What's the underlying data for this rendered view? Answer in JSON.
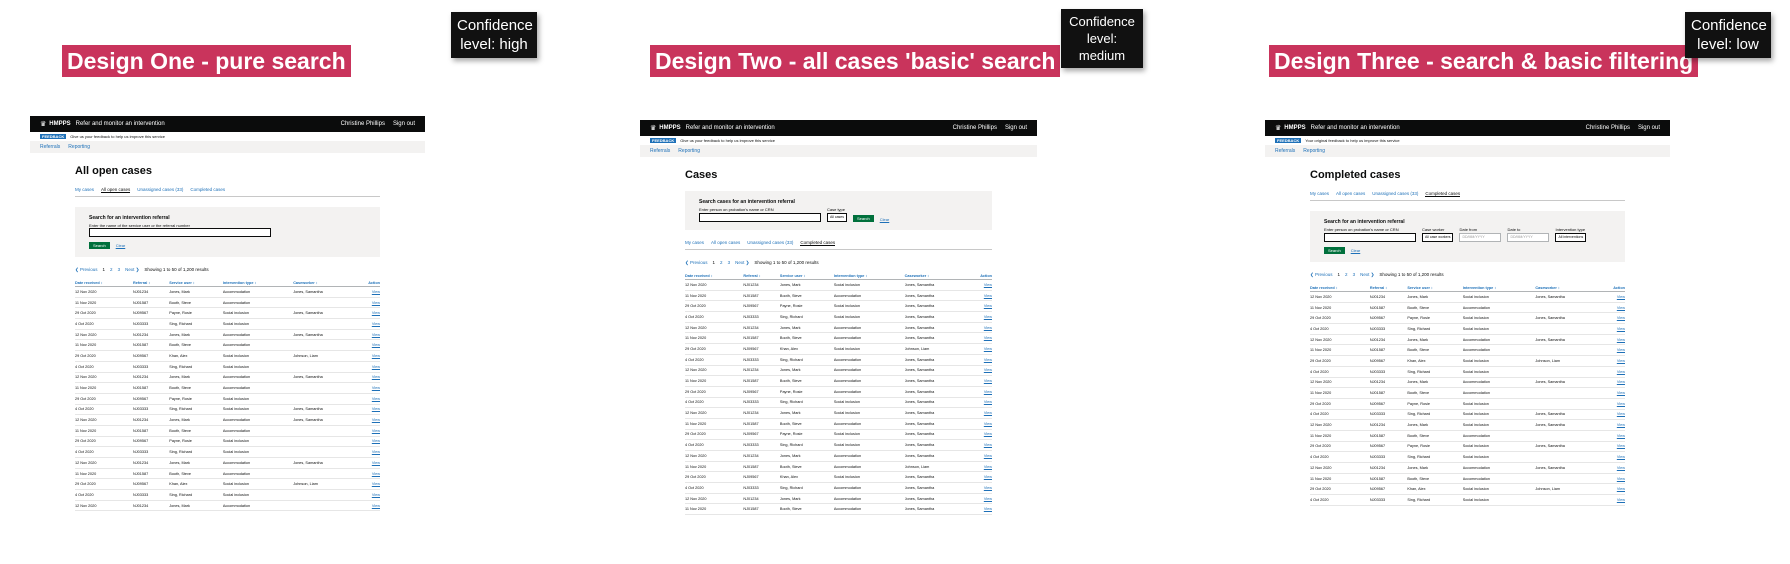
{
  "designs": [
    {
      "title": "Design One - pure search",
      "confidence": "Confidence level: high",
      "mock": {
        "header": {
          "brand": "HMPPS",
          "service": "Refer and monitor an intervention",
          "user": "Christine Phillips",
          "signout": "Sign out"
        },
        "beta": {
          "tag": "FEEDBACK",
          "text": "Give us your feedback to help us improve this service"
        },
        "nav": [
          "Referrals",
          "Reporting"
        ],
        "heading": "All open cases",
        "tabs": [
          {
            "label": "My cases",
            "active": false
          },
          {
            "label": "All open cases",
            "active": true
          },
          {
            "label": "Unassigned cases (33)",
            "active": false
          },
          {
            "label": "Completed cases",
            "active": false
          }
        ],
        "search": {
          "title": "Search for an intervention referral",
          "hint": "Enter the name of the service user or the referral number",
          "button": "Search",
          "clear": "Clear"
        },
        "pager": {
          "prev": "Previous",
          "pages": [
            "1",
            "2",
            "3"
          ],
          "next": "Next",
          "summary": "Showing 1 to 50 of 1,200 results"
        },
        "columns": [
          "Date received",
          "Referral",
          "Service user",
          "Intervention type",
          "Caseworker",
          "Action"
        ],
        "rows": [
          [
            "12 Nov 2020",
            "NJ01234",
            "Jones, Mark",
            "Accommodation",
            "Jones, Samantha",
            "View"
          ],
          [
            "11 Nov 2020",
            "NJ01587",
            "Booth, Steve",
            "Accommodation",
            "",
            "View"
          ],
          [
            "29 Oct 2020",
            "NJ09567",
            "Payne, Rosie",
            "Social inclusion",
            "Jones, Samantha",
            "View"
          ],
          [
            "4 Oct 2020",
            "NJ03333",
            "Sing, Richard",
            "Social inclusion",
            "",
            "View"
          ],
          [
            "12 Nov 2020",
            "NJ01234",
            "Jones, Mark",
            "Accommodation",
            "Jones, Samantha",
            "View"
          ],
          [
            "11 Nov 2020",
            "NJ01587",
            "Booth, Steve",
            "Accommodation",
            "",
            "View"
          ],
          [
            "29 Oct 2020",
            "NJ09567",
            "Khan, Alex",
            "Social inclusion",
            "Johnson, Liam",
            "View"
          ],
          [
            "4 Oct 2020",
            "NJ03333",
            "Sing, Richard",
            "Social inclusion",
            "",
            "View"
          ],
          [
            "12 Nov 2020",
            "NJ01234",
            "Jones, Mark",
            "Accommodation",
            "Jones, Samantha",
            "View"
          ],
          [
            "11 Nov 2020",
            "NJ01587",
            "Booth, Steve",
            "Accommodation",
            "",
            "View"
          ],
          [
            "29 Oct 2020",
            "NJ09567",
            "Payne, Rosie",
            "Social inclusion",
            "",
            "View"
          ],
          [
            "4 Oct 2020",
            "NJ03333",
            "Sing, Richard",
            "Social inclusion",
            "Jones, Samantha",
            "View"
          ],
          [
            "12 Nov 2020",
            "NJ01234",
            "Jones, Mark",
            "Accommodation",
            "Jones, Samantha",
            "View"
          ],
          [
            "11 Nov 2020",
            "NJ01587",
            "Booth, Steve",
            "Accommodation",
            "",
            "View"
          ],
          [
            "29 Oct 2020",
            "NJ09567",
            "Payne, Rosie",
            "Social inclusion",
            "",
            "View"
          ],
          [
            "4 Oct 2020",
            "NJ03333",
            "Sing, Richard",
            "Social inclusion",
            "",
            "View"
          ],
          [
            "12 Nov 2020",
            "NJ01234",
            "Jones, Mark",
            "Accommodation",
            "Jones, Samantha",
            "View"
          ],
          [
            "11 Nov 2020",
            "NJ01587",
            "Booth, Steve",
            "Accommodation",
            "",
            "View"
          ],
          [
            "29 Oct 2020",
            "NJ09567",
            "Khan, Alex",
            "Social inclusion",
            "Johnson, Liam",
            "View"
          ],
          [
            "4 Oct 2020",
            "NJ03333",
            "Sing, Richard",
            "Social inclusion",
            "",
            "View"
          ],
          [
            "12 Nov 2020",
            "NJ01234",
            "Jones, Mark",
            "Accommodation",
            "",
            "View"
          ]
        ]
      }
    },
    {
      "title": "Design Two - all cases 'basic' search",
      "confidence": "Confidence level: medium",
      "mock": {
        "header": {
          "brand": "HMPPS",
          "service": "Refer and monitor an intervention",
          "user": "Christine Phillips",
          "signout": "Sign out"
        },
        "beta": {
          "tag": "FEEDBACK",
          "text": "Give us your feedback to help us improve this service"
        },
        "nav": [
          "Referrals",
          "Reporting"
        ],
        "heading": "Cases",
        "tabs": [
          {
            "label": "My cases",
            "active": false
          },
          {
            "label": "All open cases",
            "active": false
          },
          {
            "label": "Unassigned cases (33)",
            "active": false
          },
          {
            "label": "Completed cases",
            "active": true
          }
        ],
        "search": {
          "title": "Search cases for an intervention referral",
          "hint": "Enter person on probation's name or CRN",
          "case_type_label": "Case type",
          "case_type_value": "All cases",
          "button": "Search",
          "clear": "Clear"
        },
        "pager": {
          "prev": "Previous",
          "pages": [
            "1",
            "2",
            "3"
          ],
          "next": "Next",
          "summary": "Showing 1 to 50 of 1,200 results"
        },
        "columns": [
          "Date received",
          "Referral",
          "Service user",
          "Intervention type",
          "Caseworker",
          "Action"
        ],
        "rows": [
          [
            "12 Nov 2020",
            "NJ01234",
            "Jones, Mark",
            "Social inclusion",
            "Jones, Samantha",
            "View"
          ],
          [
            "11 Nov 2020",
            "NJ01587",
            "Booth, Steve",
            "Accommodation",
            "Jones, Samantha",
            "View"
          ],
          [
            "29 Oct 2020",
            "NJ09567",
            "Payne, Rosie",
            "Social inclusion",
            "Jones, Samantha",
            "View"
          ],
          [
            "4 Oct 2020",
            "NJ03333",
            "Sing, Richard",
            "Social inclusion",
            "Jones, Samantha",
            "View"
          ],
          [
            "12 Nov 2020",
            "NJ01234",
            "Jones, Mark",
            "Accommodation",
            "Jones, Samantha",
            "View"
          ],
          [
            "11 Nov 2020",
            "NJ01587",
            "Booth, Steve",
            "Accommodation",
            "Jones, Samantha",
            "View"
          ],
          [
            "29 Oct 2020",
            "NJ09567",
            "Khan, Alex",
            "Social inclusion",
            "Johnson, Liam",
            "View"
          ],
          [
            "4 Oct 2020",
            "NJ03333",
            "Sing, Richard",
            "Accommodation",
            "Jones, Samantha",
            "View"
          ],
          [
            "12 Nov 2020",
            "NJ01234",
            "Jones, Mark",
            "Accommodation",
            "Jones, Samantha",
            "View"
          ],
          [
            "11 Nov 2020",
            "NJ01587",
            "Booth, Steve",
            "Accommodation",
            "Jones, Samantha",
            "View"
          ],
          [
            "29 Oct 2020",
            "NJ09567",
            "Payne, Rosie",
            "Accommodation",
            "Jones, Samantha",
            "View"
          ],
          [
            "4 Oct 2020",
            "NJ03333",
            "Sing, Richard",
            "Social inclusion",
            "Jones, Samantha",
            "View"
          ],
          [
            "12 Nov 2020",
            "NJ01234",
            "Jones, Mark",
            "Social inclusion",
            "Jones, Samantha",
            "View"
          ],
          [
            "11 Nov 2020",
            "NJ01587",
            "Booth, Steve",
            "Accommodation",
            "Jones, Samantha",
            "View"
          ],
          [
            "29 Oct 2020",
            "NJ09567",
            "Payne, Rosie",
            "Social inclusion",
            "Jones, Samantha",
            "View"
          ],
          [
            "4 Oct 2020",
            "NJ03333",
            "Sing, Richard",
            "Social inclusion",
            "Jones, Samantha",
            "View"
          ],
          [
            "12 Nov 2020",
            "NJ01234",
            "Jones, Mark",
            "Accommodation",
            "Jones, Samantha",
            "View"
          ],
          [
            "11 Nov 2020",
            "NJ01587",
            "Booth, Steve",
            "Accommodation",
            "Johnson, Liam",
            "View"
          ],
          [
            "29 Oct 2020",
            "NJ09567",
            "Khan, Alex",
            "Social inclusion",
            "Jones, Samantha",
            "View"
          ],
          [
            "4 Oct 2020",
            "NJ03333",
            "Sing, Richard",
            "Accommodation",
            "Jones, Samantha",
            "View"
          ],
          [
            "12 Nov 2020",
            "NJ01234",
            "Jones, Mark",
            "Accommodation",
            "Jones, Samantha",
            "View"
          ],
          [
            "11 Nov 2020",
            "NJ01587",
            "Booth, Steve",
            "Accommodation",
            "Jones, Samantha",
            "View"
          ]
        ]
      }
    },
    {
      "title": "Design Three - search & basic filtering",
      "confidence": "Confidence level: low",
      "mock": {
        "header": {
          "brand": "HMPPS",
          "service": "Refer and monitor an intervention",
          "user": "Christine Phillips",
          "signout": "Sign out"
        },
        "beta": {
          "tag": "FEEDBACK",
          "text": "Your original feedback to help us improve this service"
        },
        "nav": [
          "Referrals",
          "Reporting"
        ],
        "heading": "Completed cases",
        "tabs": [
          {
            "label": "My cases",
            "active": false
          },
          {
            "label": "All open cases",
            "active": false
          },
          {
            "label": "Unassigned cases (33)",
            "active": false
          },
          {
            "label": "Completed cases",
            "active": true
          }
        ],
        "search": {
          "title": "Search for an intervention referral",
          "hint": "Enter person on probation's name or CRN",
          "caseworker_label": "Case worker",
          "caseworker_value": "All case workers",
          "date_from_label": "Date from",
          "date_from_placeholder": "DD/MM/YYYY",
          "date_to_label": "Date to",
          "date_to_placeholder": "DD/MM/YYYY",
          "itype_label": "Intervention type",
          "itype_value": "All interventions",
          "button": "Search",
          "clear": "Clear"
        },
        "pager": {
          "prev": "Previous",
          "pages": [
            "1",
            "2",
            "3"
          ],
          "next": "Next",
          "summary": "Showing 1 to 50 of 1,200 results"
        },
        "columns": [
          "Date received",
          "Referral",
          "Service user",
          "Intervention type",
          "Caseworker",
          "Action"
        ],
        "rows": [
          [
            "12 Nov 2020",
            "NJ01234",
            "Jones, Mark",
            "Social inclusion",
            "Jones, Samantha",
            "View"
          ],
          [
            "11 Nov 2020",
            "NJ01587",
            "Booth, Steve",
            "Accommodation",
            "",
            "View"
          ],
          [
            "29 Oct 2020",
            "NJ09567",
            "Payne, Rosie",
            "Social inclusion",
            "Jones, Samantha",
            "View"
          ],
          [
            "4 Oct 2020",
            "NJ03333",
            "Sing, Richard",
            "Social inclusion",
            "",
            "View"
          ],
          [
            "12 Nov 2020",
            "NJ01234",
            "Jones, Mark",
            "Accommodation",
            "Jones, Samantha",
            "View"
          ],
          [
            "11 Nov 2020",
            "NJ01587",
            "Booth, Steve",
            "Accommodation",
            "",
            "View"
          ],
          [
            "29 Oct 2020",
            "NJ09567",
            "Khan, Alex",
            "Social inclusion",
            "Johnson, Liam",
            "View"
          ],
          [
            "4 Oct 2020",
            "NJ03333",
            "Sing, Richard",
            "Social inclusion",
            "",
            "View"
          ],
          [
            "12 Nov 2020",
            "NJ01234",
            "Jones, Mark",
            "Accommodation",
            "Jones, Samantha",
            "View"
          ],
          [
            "11 Nov 2020",
            "NJ01587",
            "Booth, Steve",
            "Accommodation",
            "",
            "View"
          ],
          [
            "29 Oct 2020",
            "NJ09567",
            "Payne, Rosie",
            "Social inclusion",
            "",
            "View"
          ],
          [
            "4 Oct 2020",
            "NJ03333",
            "Sing, Richard",
            "Social inclusion",
            "Jones, Samantha",
            "View"
          ],
          [
            "12 Nov 2020",
            "NJ01234",
            "Jones, Mark",
            "Social inclusion",
            "Jones, Samantha",
            "View"
          ],
          [
            "11 Nov 2020",
            "NJ01587",
            "Booth, Steve",
            "Accommodation",
            "",
            "View"
          ],
          [
            "29 Oct 2020",
            "NJ09567",
            "Payne, Rosie",
            "Social inclusion",
            "Jones, Samantha",
            "View"
          ],
          [
            "4 Oct 2020",
            "NJ03333",
            "Sing, Richard",
            "Social inclusion",
            "",
            "View"
          ],
          [
            "12 Nov 2020",
            "NJ01234",
            "Jones, Mark",
            "Accommodation",
            "Jones, Samantha",
            "View"
          ],
          [
            "11 Nov 2020",
            "NJ01587",
            "Booth, Steve",
            "Accommodation",
            "",
            "View"
          ],
          [
            "29 Oct 2020",
            "NJ09567",
            "Khan, Alex",
            "Social inclusion",
            "Johnson, Liam",
            "View"
          ],
          [
            "4 Oct 2020",
            "NJ03333",
            "Sing, Richard",
            "Social inclusion",
            "",
            "View"
          ]
        ]
      }
    }
  ]
}
